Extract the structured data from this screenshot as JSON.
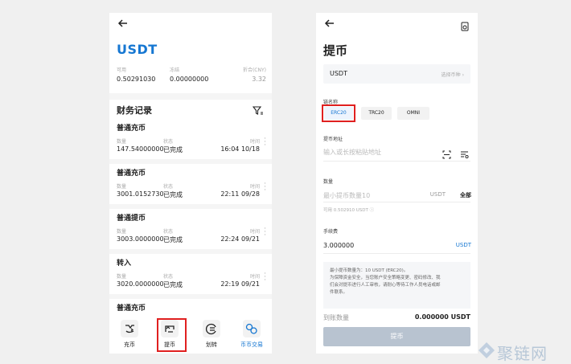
{
  "left": {
    "coin": "USDT",
    "balances": [
      {
        "label": "可用",
        "value": "0.50291030"
      },
      {
        "label": "冻结",
        "value": "0.00000000"
      },
      {
        "label": "折合(CNY)",
        "value": "3.32"
      }
    ],
    "records_title": "财务记录",
    "col_labels": {
      "amount": "数量",
      "status": "状态",
      "time": "时间"
    },
    "records": [
      {
        "type": "普通充币",
        "amount": "147.54000000",
        "status": "已完成",
        "time": "16:04 10/18"
      },
      {
        "type": "普通充币",
        "amount": "3001.0152730",
        "status": "已完成",
        "time": "22:11 09/28"
      },
      {
        "type": "普通提币",
        "amount": "3003.0000000",
        "status": "已完成",
        "time": "22:24 09/21"
      },
      {
        "type": "转入",
        "amount": "3020.0000000",
        "status": "已完成",
        "time": "22:19 09/21"
      },
      {
        "type": "普通充币"
      }
    ],
    "tabs": [
      {
        "label": "充币",
        "icon": "deposit-icon"
      },
      {
        "label": "提币",
        "icon": "withdraw-icon"
      },
      {
        "label": "划转",
        "icon": "transfer-icon"
      },
      {
        "label": "币币交易",
        "icon": "trade-icon"
      }
    ],
    "accent": "#1677d2",
    "highlight": "#e02020"
  },
  "right": {
    "title": "提币",
    "coin": "USDT",
    "select_coin": "选择币种",
    "chain_label": "链名称",
    "chains": [
      "ERC20",
      "TRC20",
      "OMNI"
    ],
    "selected_chain": "ERC20",
    "address_label": "提币地址",
    "address_placeholder": "输入或长按粘贴地址",
    "amount_label": "数量",
    "amount_placeholder": "最小提币数量10",
    "amount_unit": "USDT",
    "all_label": "全部",
    "available": "可用 0.502910 USDT",
    "fee_label": "手续费",
    "fee_value": "3.000000",
    "fee_unit": "USDT",
    "notice_lines": [
      "最小提币数量为：10 USDT (ERC20)。",
      "为保障资金安全，当您账户安全策略变更、密码修改、我",
      "们会对提币进行人工审核，请耐心等待工作人员电话或邮",
      "件联系。"
    ],
    "arrival_label": "到账数量",
    "arrival_value": "0.000000 USDT",
    "submit_label": "提币"
  },
  "watermark": "聚链网"
}
